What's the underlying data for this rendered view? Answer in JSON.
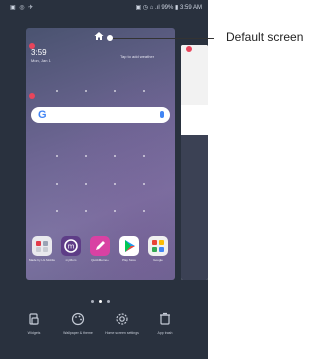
{
  "status_bar": {
    "left_icons": "▣ ◎ ✈",
    "right_text": "▣ ◷ ⌂ .ıl 99% ▮ 3:59 AM"
  },
  "home_preview": {
    "time": "3:59",
    "date": "Mon, Jan 1",
    "weather_hint": "Tap to add weather",
    "search_logo": "G",
    "apps": [
      {
        "label": "Made by LG Mobile",
        "icon": "folder-icon",
        "color": "#e9e9ee"
      },
      {
        "label": "myMom",
        "icon": "mymom-icon",
        "color": "#5e3d87"
      },
      {
        "label": "QuickMemo+",
        "icon": "pencil-icon",
        "color": "#d941a3"
      },
      {
        "label": "Play Store",
        "icon": "play-store-icon",
        "color": "#ffffff"
      },
      {
        "label": "Google",
        "icon": "google-folder-icon",
        "color": "#f0f0f0"
      }
    ]
  },
  "toolbar": {
    "items": [
      {
        "label": "Widgets",
        "icon": "widgets-icon"
      },
      {
        "label": "Wallpaper & theme",
        "icon": "palette-icon"
      },
      {
        "label": "Home screen settings",
        "icon": "gear-icon"
      },
      {
        "label": "App trash",
        "icon": "trash-icon"
      }
    ]
  },
  "callout": {
    "label": "Default screen"
  },
  "colors": {
    "background": "#29313e",
    "remove_badge": "#e8455b",
    "accent": "#4285f4"
  }
}
